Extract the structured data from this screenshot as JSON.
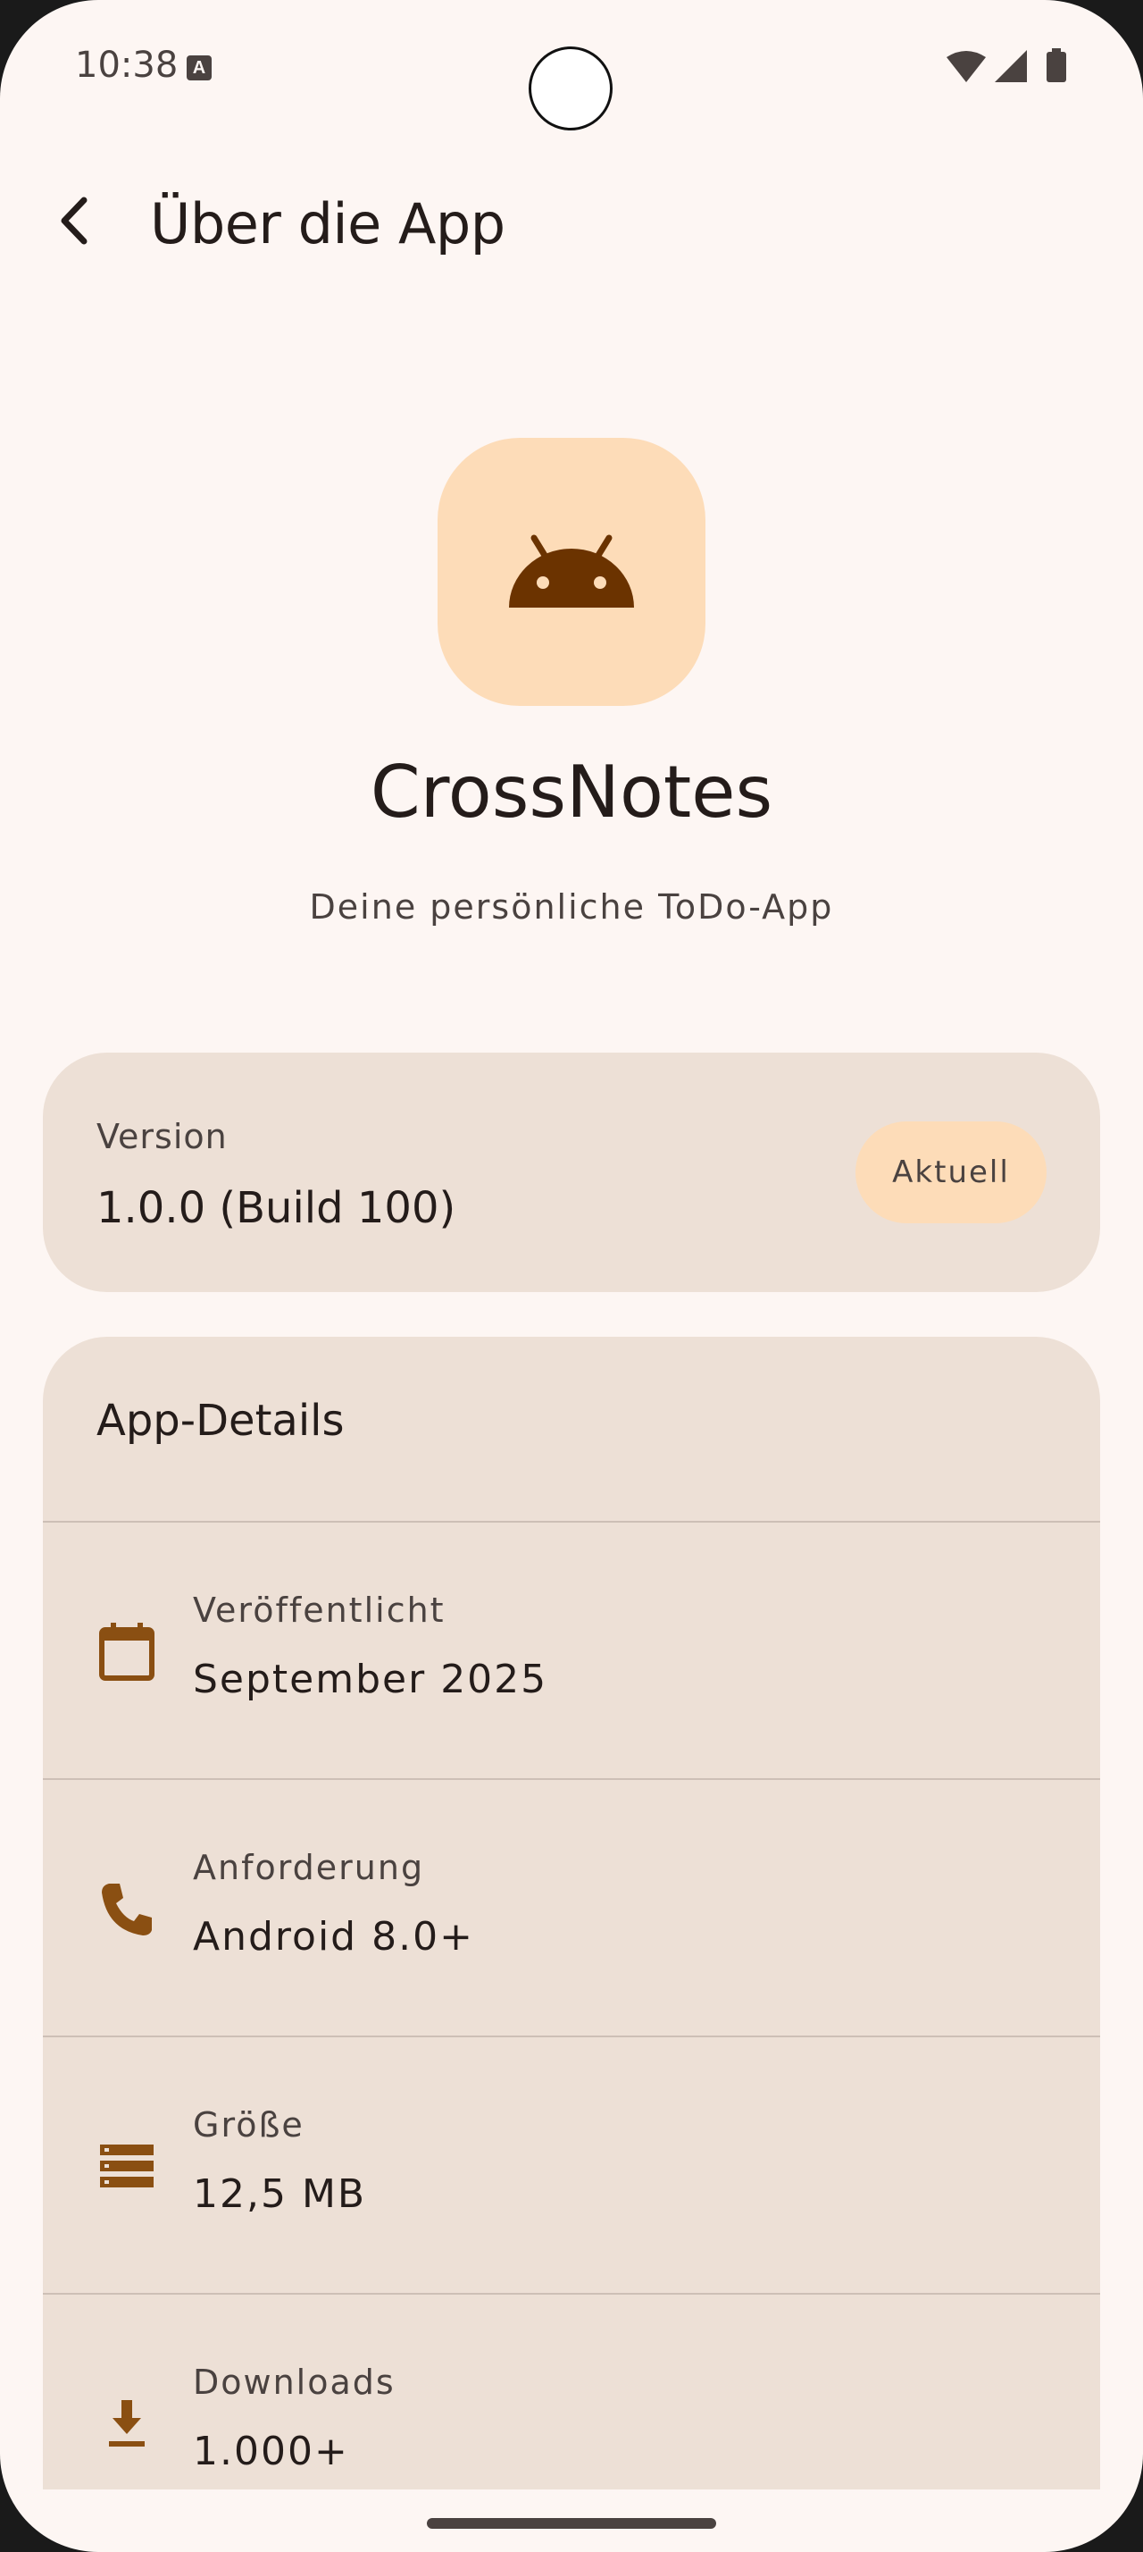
{
  "status_bar": {
    "time": "10:38"
  },
  "header": {
    "title": "Über die App"
  },
  "app": {
    "name": "CrossNotes",
    "description": "Deine persönliche ToDo-App",
    "icon": "android-icon"
  },
  "version_card": {
    "label": "Version",
    "value": "1.0.0 (Build 100)",
    "badge": "Aktuell"
  },
  "details": {
    "title": "App-Details",
    "items": [
      {
        "label": "Veröffentlicht",
        "value": "September 2025",
        "icon": "calendar-icon"
      },
      {
        "label": "Anforderung",
        "value": "Android 8.0+",
        "icon": "phone-icon"
      },
      {
        "label": "Größe",
        "value": "12,5 MB",
        "icon": "storage-icon"
      },
      {
        "label": "Downloads",
        "value": "1.000+",
        "icon": "download-icon"
      }
    ]
  },
  "colors": {
    "background": "#fdf6f3",
    "card": "#ede0d6",
    "accent_container": "#fddcb8",
    "icon_brown": "#8a4f12",
    "android_brown": "#6b3300"
  }
}
